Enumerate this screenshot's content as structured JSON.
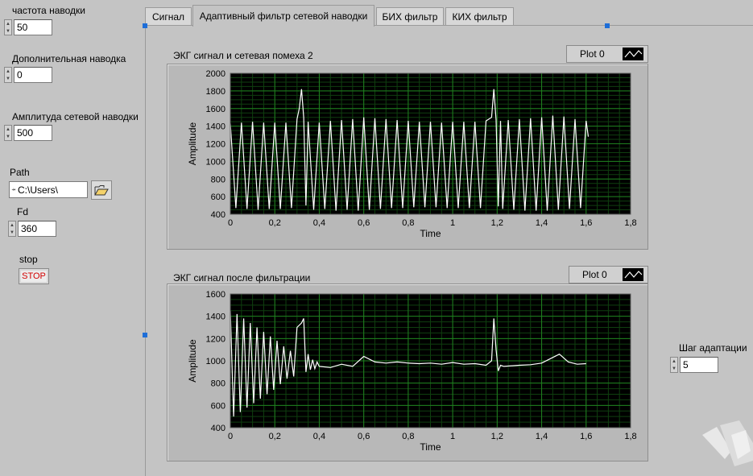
{
  "controls": {
    "noise_freq": {
      "label": "частота наводки",
      "value": "50"
    },
    "extra_noise": {
      "label": "Дополнительная наводка",
      "value": "0"
    },
    "noise_amp": {
      "label": "Амплитуда сетевой наводки",
      "value": "500"
    },
    "path": {
      "label": "Path",
      "value": "C:\\Users\\"
    },
    "fd": {
      "label": "Fd",
      "value": "360"
    },
    "stop": {
      "label": "stop",
      "button_text": "STOP"
    },
    "step": {
      "label": "Шаг адаптации",
      "value": "5"
    }
  },
  "tabs": [
    {
      "label": "Сигнал",
      "active": false
    },
    {
      "label": "Адаптивный фильтр сетевой наводки",
      "active": true
    },
    {
      "label": "БИХ фильтр",
      "active": false
    },
    {
      "label": "КИХ фильтр",
      "active": false
    }
  ],
  "colors": {
    "plot_bg": "#000000",
    "grid": "#1f7f1f",
    "trace": "#ffffff",
    "panel": "#c4c4c4",
    "stop_text": "#d20000",
    "handle": "#1e6ed8"
  },
  "chart_data": [
    {
      "type": "line",
      "title": "ЭКГ сигнал и сетевая помеха 2",
      "xlabel": "Time",
      "ylabel": "Amplitude",
      "xlim": [
        0,
        1.8
      ],
      "ylim": [
        400,
        2000
      ],
      "xticks": [
        "0",
        "0,2",
        "0,4",
        "0,6",
        "0,8",
        "1",
        "1,2",
        "1,4",
        "1,6",
        "1,8"
      ],
      "yticks": [
        "400",
        "600",
        "800",
        "1000",
        "1200",
        "1400",
        "1600",
        "1800",
        "2000"
      ],
      "grid": true,
      "legend": "Plot 0",
      "series": [
        {
          "name": "Plot 0",
          "x": [
            0.0,
            0.025,
            0.05,
            0.075,
            0.1,
            0.125,
            0.15,
            0.175,
            0.2,
            0.225,
            0.25,
            0.275,
            0.3,
            0.31,
            0.32,
            0.33,
            0.34,
            0.35,
            0.375,
            0.4,
            0.425,
            0.45,
            0.475,
            0.5,
            0.525,
            0.55,
            0.575,
            0.6,
            0.625,
            0.65,
            0.675,
            0.7,
            0.725,
            0.75,
            0.775,
            0.8,
            0.825,
            0.85,
            0.875,
            0.9,
            0.925,
            0.95,
            0.975,
            1.0,
            1.025,
            1.05,
            1.075,
            1.1,
            1.125,
            1.15,
            1.175,
            1.185,
            1.195,
            1.205,
            1.215,
            1.225,
            1.25,
            1.275,
            1.3,
            1.325,
            1.35,
            1.375,
            1.4,
            1.425,
            1.45,
            1.475,
            1.5,
            1.525,
            1.55,
            1.575,
            1.6,
            1.61
          ],
          "y": [
            1430,
            470,
            1440,
            460,
            1450,
            450,
            1440,
            460,
            1440,
            460,
            1440,
            470,
            1480,
            1600,
            1820,
            1500,
            500,
            1450,
            450,
            1440,
            460,
            1460,
            440,
            1470,
            450,
            1480,
            440,
            1500,
            450,
            1490,
            460,
            1480,
            470,
            1470,
            470,
            1460,
            480,
            1450,
            480,
            1450,
            480,
            1440,
            470,
            1450,
            470,
            1450,
            470,
            1450,
            470,
            1460,
            1500,
            1820,
            1470,
            490,
            1460,
            460,
            1470,
            450,
            1480,
            440,
            1490,
            440,
            1500,
            440,
            1520,
            450,
            1510,
            460,
            1480,
            470,
            1460,
            1280
          ]
        }
      ]
    },
    {
      "type": "line",
      "title": "ЭКГ сигнал после фильтрации",
      "xlabel": "Time",
      "ylabel": "Amplitude",
      "xlim": [
        0,
        1.8
      ],
      "ylim": [
        400,
        1600
      ],
      "xticks": [
        "0",
        "0,2",
        "0,4",
        "0,6",
        "0,8",
        "1",
        "1,2",
        "1,4",
        "1,6",
        "1,8"
      ],
      "yticks": [
        "400",
        "600",
        "800",
        "1000",
        "1200",
        "1400",
        "1600"
      ],
      "grid": true,
      "legend": "Plot 0",
      "series": [
        {
          "name": "Plot 0",
          "x": [
            0.0,
            0.015,
            0.03,
            0.045,
            0.06,
            0.075,
            0.09,
            0.105,
            0.12,
            0.135,
            0.15,
            0.165,
            0.18,
            0.195,
            0.21,
            0.225,
            0.24,
            0.255,
            0.27,
            0.285,
            0.3,
            0.32,
            0.33,
            0.34,
            0.35,
            0.36,
            0.37,
            0.38,
            0.39,
            0.4,
            0.45,
            0.5,
            0.55,
            0.6,
            0.65,
            0.7,
            0.75,
            0.8,
            0.85,
            0.9,
            0.95,
            1.0,
            1.05,
            1.1,
            1.15,
            1.175,
            1.185,
            1.195,
            1.205,
            1.215,
            1.23,
            1.3,
            1.35,
            1.4,
            1.45,
            1.48,
            1.52,
            1.56,
            1.6
          ],
          "y": [
            1450,
            500,
            1420,
            540,
            1380,
            580,
            1340,
            620,
            1300,
            660,
            1260,
            700,
            1220,
            740,
            1180,
            790,
            1130,
            840,
            1090,
            860,
            1300,
            1340,
            1380,
            900,
            1060,
            920,
            1010,
            930,
            990,
            950,
            940,
            970,
            950,
            1040,
            990,
            980,
            990,
            980,
            975,
            980,
            970,
            985,
            970,
            975,
            960,
            1000,
            1380,
            1100,
            910,
            960,
            950,
            960,
            965,
            980,
            1030,
            1060,
            990,
            970,
            975
          ]
        }
      ]
    }
  ]
}
